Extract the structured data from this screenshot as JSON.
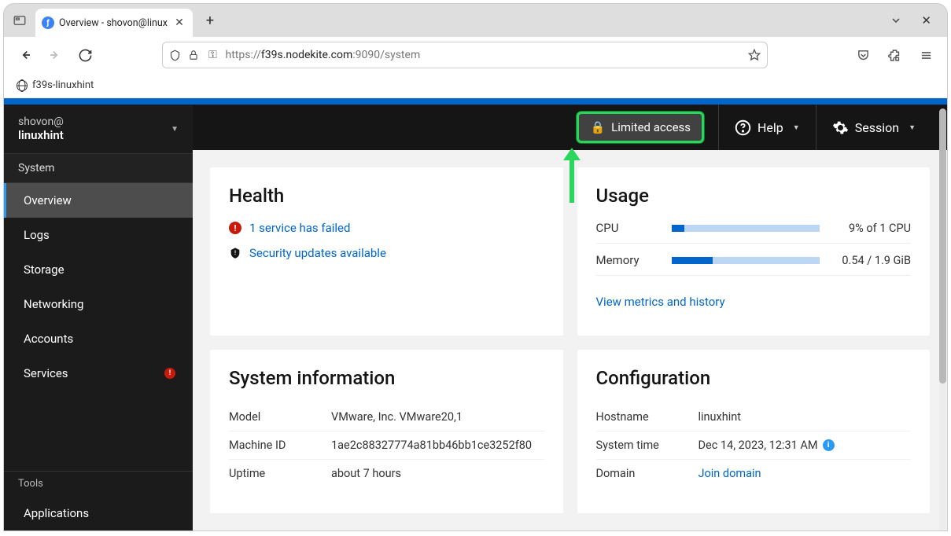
{
  "browser": {
    "tab_title": "Overview - shovon@linux",
    "url_proto": "https://",
    "url_dark": "f39s.nodekite.com",
    "url_rest": ":9090/system",
    "bookmark": "f39s-linuxhint"
  },
  "sidebar": {
    "user": "shovon@",
    "host": "linuxhint",
    "section": "System",
    "items": [
      {
        "label": "Overview",
        "active": true
      },
      {
        "label": "Logs"
      },
      {
        "label": "Storage"
      },
      {
        "label": "Networking"
      },
      {
        "label": "Accounts"
      },
      {
        "label": "Services",
        "alert": true
      }
    ],
    "tools_label": "Tools",
    "tools_items": [
      {
        "label": "Applications"
      }
    ]
  },
  "masthead": {
    "limited": "Limited access",
    "help": "Help",
    "session": "Session"
  },
  "health": {
    "title": "Health",
    "service_failed": "1 service has failed",
    "security_updates": "Security updates available"
  },
  "usage": {
    "title": "Usage",
    "cpu_label": "CPU",
    "cpu_pct": 9,
    "cpu_text": "9% of 1 CPU",
    "mem_label": "Memory",
    "mem_pct": 28,
    "mem_text": "0.54 / 1.9 GiB",
    "metrics_link": "View metrics and history"
  },
  "sysinfo": {
    "title": "System information",
    "rows": [
      {
        "label": "Model",
        "value": "VMware, Inc. VMware20,1"
      },
      {
        "label": "Machine ID",
        "value": "1ae2c88327774a81bb46bb1ce3252f80"
      },
      {
        "label": "Uptime",
        "value": "about 7 hours"
      }
    ]
  },
  "config": {
    "title": "Configuration",
    "rows": [
      {
        "label": "Hostname",
        "value": "linuxhint"
      },
      {
        "label": "System time",
        "value": "Dec 14, 2023, 12:31 AM",
        "info": true
      },
      {
        "label": "Domain",
        "value": "Join domain",
        "link": true
      }
    ]
  }
}
